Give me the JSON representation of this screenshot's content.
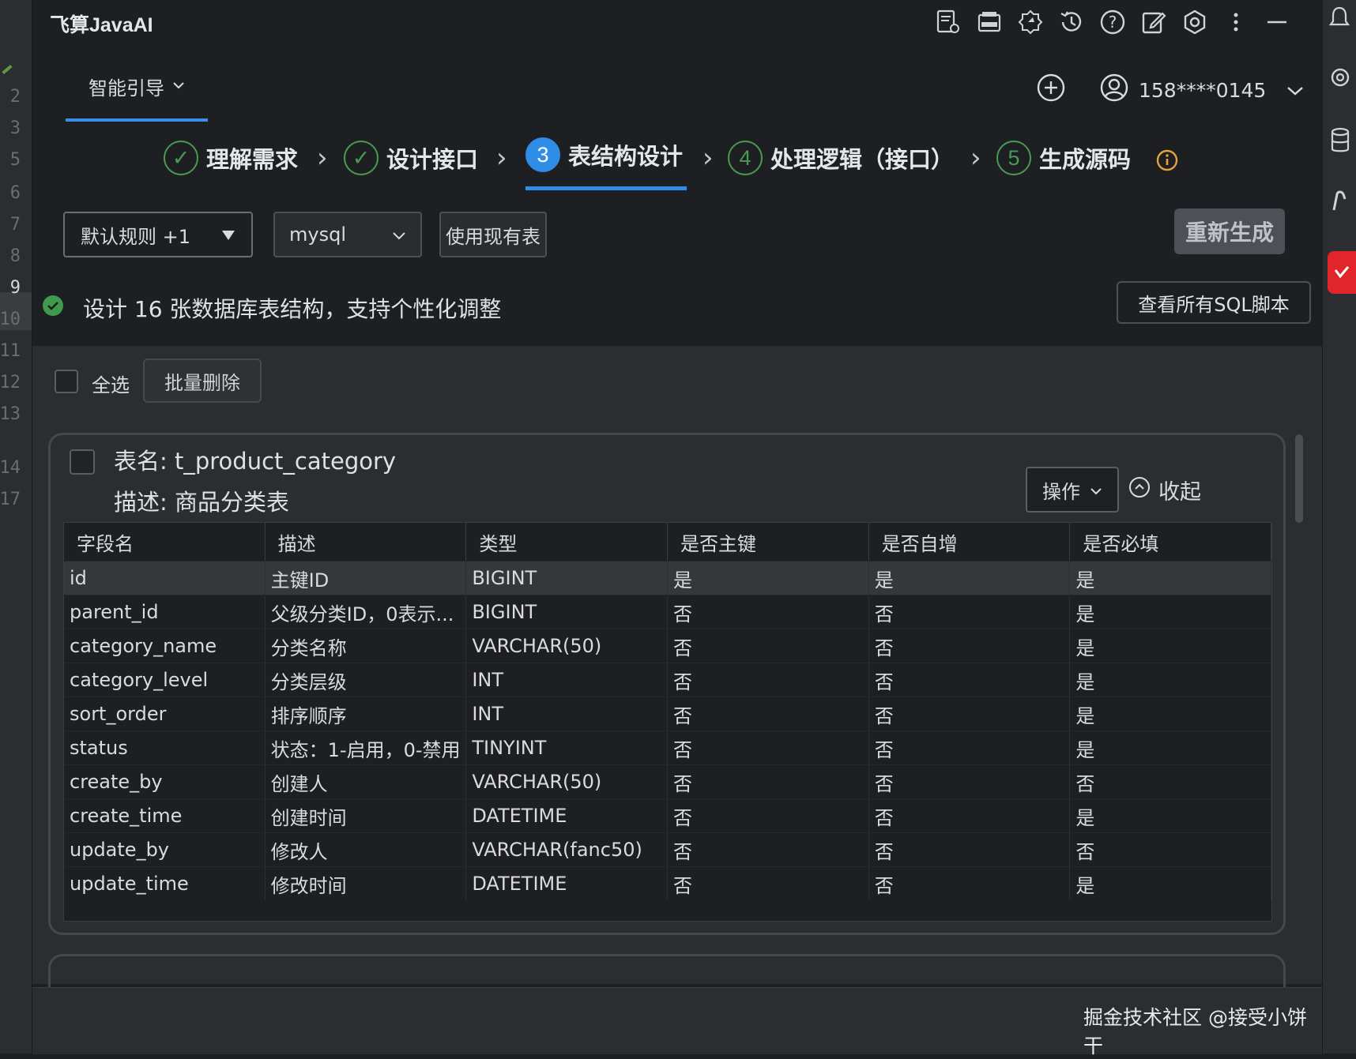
{
  "app_title": "飞算JavaAI",
  "gutter_lines": [
    "2",
    "3",
    "5",
    "6",
    "7",
    "8",
    "9",
    "10",
    "11",
    "12",
    "13",
    "14",
    "17"
  ],
  "top_icons": [
    "report-settings-icon",
    "mcp-icon",
    "gear-cog-icon",
    "history-icon",
    "help-icon",
    "edit-icon",
    "settings-hex-icon",
    "more-vertical-icon",
    "minimize-icon"
  ],
  "guide_tab": {
    "label": "智能引导"
  },
  "account": {
    "phone": "158****0145"
  },
  "steps": [
    {
      "num": "✓",
      "label": "理解需求"
    },
    {
      "num": "✓",
      "label": "设计接口"
    },
    {
      "num": "3",
      "label": "表结构设计"
    },
    {
      "num": "4",
      "label": "处理逻辑（接口）"
    },
    {
      "num": "5",
      "label": "生成源码"
    }
  ],
  "controls": {
    "rule_select": "默认规则 +1",
    "db_select": "mysql",
    "existing_table": "使用现有表",
    "regenerate": "重新生成",
    "view_sql": "查看所有SQL脚本"
  },
  "status_text": "设计 16 张数据库表结构，支持个性化调整",
  "list": {
    "select_all": "全选",
    "batch_delete": "批量删除"
  },
  "table_card": {
    "name": "表名: t_product_category",
    "desc": "描述: 商品分类表",
    "ops_label": "操作",
    "collapse_label": "收起",
    "columns": [
      "字段名",
      "描述",
      "类型",
      "是否主键",
      "是否自增",
      "是否必填"
    ],
    "rows": [
      [
        "id",
        "主键ID",
        "BIGINT",
        "是",
        "是",
        "是"
      ],
      [
        "parent_id",
        "父级分类ID，0表示...",
        "BIGINT",
        "否",
        "否",
        "是"
      ],
      [
        "category_name",
        "分类名称",
        "VARCHAR(50)",
        "否",
        "否",
        "是"
      ],
      [
        "category_level",
        "分类层级",
        "INT",
        "否",
        "否",
        "是"
      ],
      [
        "sort_order",
        "排序顺序",
        "INT",
        "否",
        "否",
        "是"
      ],
      [
        "status",
        "状态：1-启用，0-禁用",
        "TINYINT",
        "否",
        "否",
        "是"
      ],
      [
        "create_by",
        "创建人",
        "VARCHAR(50)",
        "否",
        "否",
        "否"
      ],
      [
        "create_time",
        "创建时间",
        "DATETIME",
        "否",
        "否",
        "是"
      ],
      [
        "update_by",
        "修改人",
        "VARCHAR(fanc50)",
        "否",
        "否",
        "否"
      ],
      [
        "update_time",
        "修改时间",
        "DATETIME",
        "否",
        "否",
        "是"
      ]
    ]
  },
  "watermark": "掘金技术社区 @接受小饼干",
  "colors": {
    "accent": "#2f8de8",
    "success": "#4b9a52",
    "warning": "#e6a23c"
  }
}
